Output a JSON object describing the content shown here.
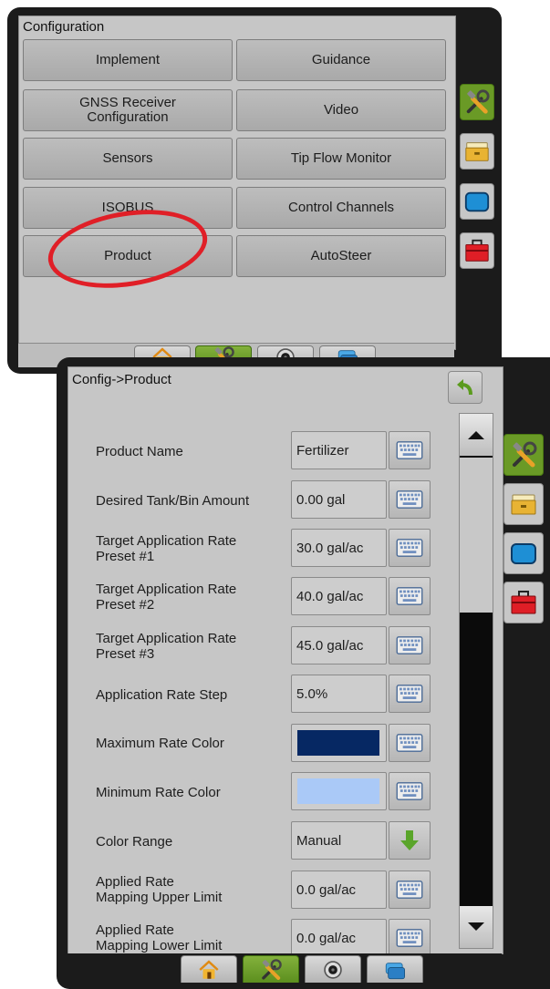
{
  "config_panel": {
    "title": "Configuration",
    "buttons": [
      {
        "label": "Implement"
      },
      {
        "label": "Guidance"
      },
      {
        "label": "GNSS Receiver\nConfiguration"
      },
      {
        "label": "Video"
      },
      {
        "label": "Sensors"
      },
      {
        "label": "Tip Flow Monitor"
      },
      {
        "label": "ISOBUS"
      },
      {
        "label": "Control Channels"
      },
      {
        "label": "Product"
      },
      {
        "label": "AutoSteer"
      }
    ],
    "side_icons": [
      "tools-icon",
      "folder-icon",
      "screen-icon",
      "toolbox-icon"
    ],
    "bottom_tabs": [
      "home-icon",
      "tools-icon",
      "camera-icon",
      "folders-icon"
    ],
    "active_tab": "tools-icon",
    "highlight": "product-button"
  },
  "product_panel": {
    "title": "Config->Product",
    "rows": [
      {
        "label": "Product Name",
        "value": "Fertilizer",
        "control": "keyboard"
      },
      {
        "label": "Desired Tank/Bin Amount",
        "value": "0.00 gal",
        "control": "keyboard"
      },
      {
        "label": "Target Application Rate\nPreset #1",
        "value": "30.0 gal/ac",
        "control": "keyboard"
      },
      {
        "label": "Target Application Rate\nPreset #2",
        "value": "40.0 gal/ac",
        "control": "keyboard"
      },
      {
        "label": "Target Application Rate\nPreset #3",
        "value": "45.0 gal/ac",
        "control": "keyboard"
      },
      {
        "label": "Application Rate Step",
        "value": "5.0%",
        "control": "keyboard"
      },
      {
        "label": "Maximum Rate Color",
        "value": "",
        "color": "#062863",
        "control": "keyboard"
      },
      {
        "label": "Minimum Rate Color",
        "value": "",
        "color": "#aac9f7",
        "control": "keyboard"
      },
      {
        "label": "Color Range",
        "value": "Manual",
        "control": "dropdown"
      },
      {
        "label": "Applied Rate\nMapping Upper Limit",
        "value": "0.0 gal/ac",
        "control": "keyboard"
      },
      {
        "label": "Applied Rate\nMapping Lower Limit",
        "value": "0.0 gal/ac",
        "control": "keyboard"
      }
    ]
  },
  "colors": {
    "active_green": "#6a9a26",
    "highlight_red": "#e01f27",
    "bezel": "#1b1b1b",
    "panel_bg": "#c6c6c6"
  }
}
